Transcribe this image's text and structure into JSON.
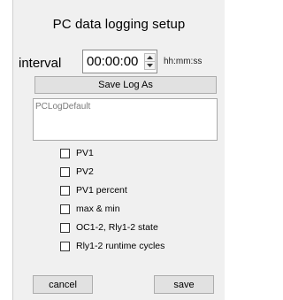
{
  "dialog": {
    "title": "PC data logging setup",
    "interval": {
      "label": "interval",
      "value": "00:00:00",
      "unit_hint": "hh:mm:ss"
    },
    "save_log_as_label": "Save Log As",
    "log_name": "PCLogDefault",
    "options": [
      {
        "label": "PV1",
        "checked": false
      },
      {
        "label": "PV2",
        "checked": false
      },
      {
        "label": "PV1 percent",
        "checked": false
      },
      {
        "label": "max & min",
        "checked": false
      },
      {
        "label": "OC1-2, Rly1-2 state",
        "checked": false
      },
      {
        "label": "Rly1-2 runtime  cycles",
        "checked": false
      }
    ],
    "cancel_label": "cancel",
    "save_label": "save"
  }
}
